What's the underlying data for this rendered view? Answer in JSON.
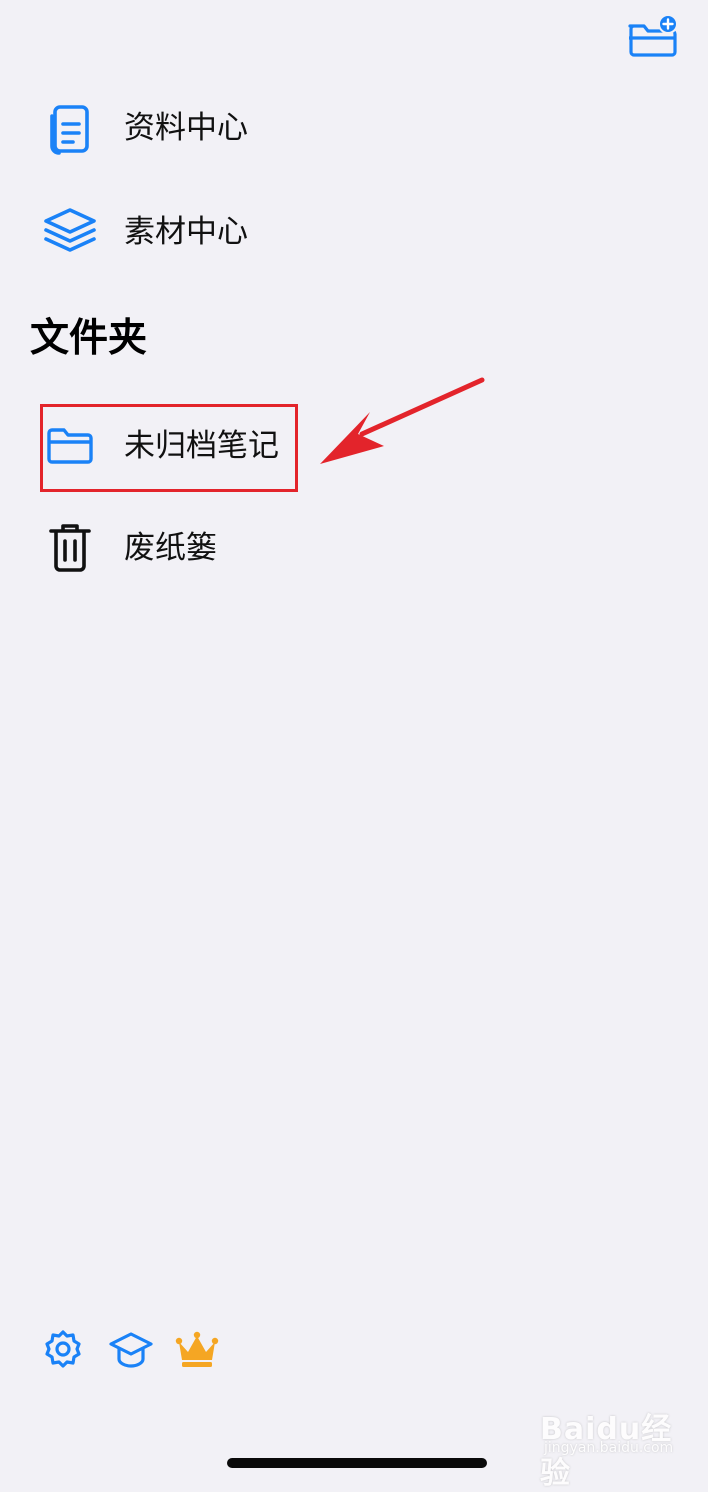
{
  "header": {
    "new_folder_icon": "folder-add-icon",
    "accent_color": "#1a82f7"
  },
  "nav": {
    "items": [
      {
        "label": "资料中心",
        "icon": "document-icon"
      },
      {
        "label": "素材中心",
        "icon": "layers-icon"
      }
    ]
  },
  "folders": {
    "title": "文件夹",
    "items": [
      {
        "label": "未归档笔记",
        "icon": "folder-icon",
        "highlighted": true
      },
      {
        "label": "废纸篓",
        "icon": "trash-icon"
      }
    ]
  },
  "annotation": {
    "highlight_color": "#e3242b",
    "arrow_color": "#e3242b"
  },
  "footer": {
    "icons": [
      "settings-icon",
      "graduation-cap-icon",
      "crown-icon"
    ],
    "crown_color": "#f5a623"
  },
  "watermark": {
    "brand": "Baidu经验",
    "url": "jingyan.baidu.com"
  }
}
